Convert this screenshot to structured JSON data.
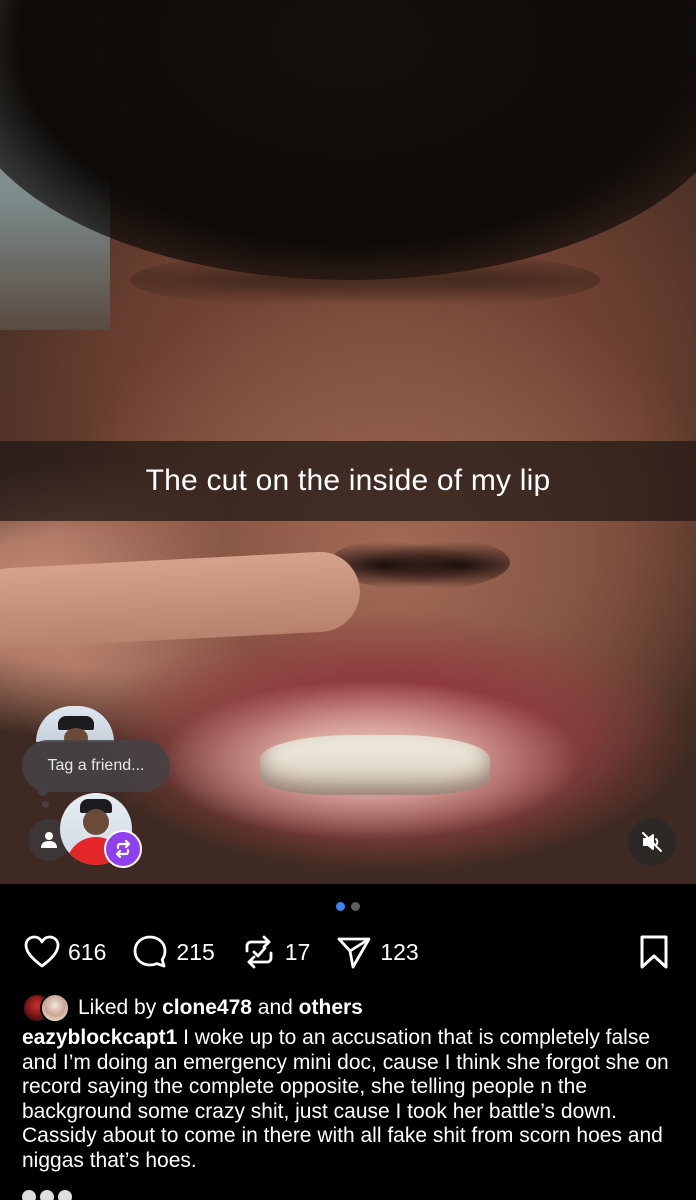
{
  "media": {
    "caption": "The cut on the inside of my lip",
    "tag_prompt": "Tag a friend...",
    "pager": {
      "count": 2,
      "active_index": 0
    },
    "muted": true
  },
  "actions": {
    "likes": "616",
    "comments": "215",
    "reposts": "17",
    "shares": "123"
  },
  "liked_by": {
    "prefix": "Liked by ",
    "user": "clone478",
    "middle": " and ",
    "others": "others"
  },
  "post": {
    "username": "eazyblockcapt1",
    "caption": " I woke up to an accusation that is completely false and I’m doing an emergency mini doc, cause I think she forgot she on record saying the complete opposite, she telling people n the background some crazy shit, just cause I took her battle’s down. Cassidy about to come in there with all fake shit from scorn hoes and niggas that’s hoes."
  },
  "colors": {
    "background": "#000000",
    "accent_blue": "#3b83f6",
    "repost_badge": "#8e3ff0"
  }
}
